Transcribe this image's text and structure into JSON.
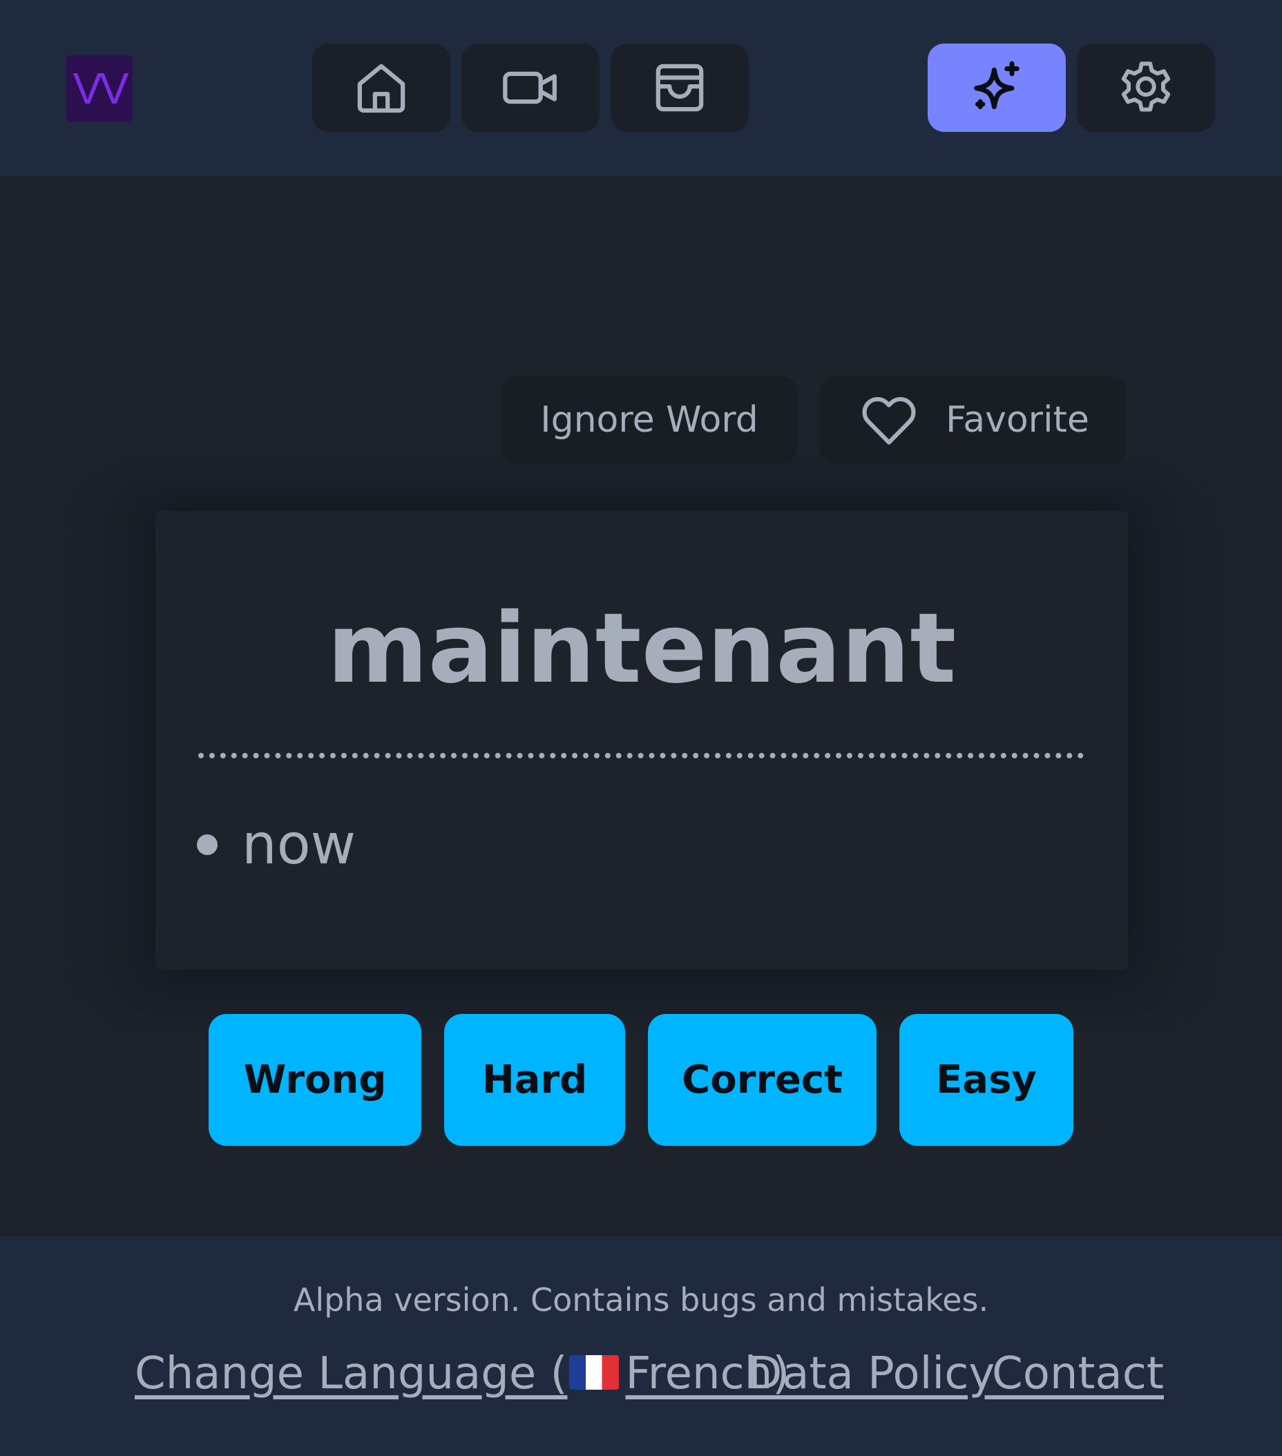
{
  "header": {
    "logo_text": "VV",
    "nav": [
      {
        "name": "home",
        "icon": "home-icon"
      },
      {
        "name": "videos",
        "icon": "video-camera-icon"
      },
      {
        "name": "inbox",
        "icon": "inbox-icon"
      }
    ],
    "right": [
      {
        "name": "ai-sparkle",
        "icon": "sparkle-icon",
        "active": true,
        "color": "#7784fd"
      },
      {
        "name": "settings",
        "icon": "gear-icon"
      }
    ]
  },
  "actions": {
    "ignore_label": "Ignore Word",
    "favorite_label": "Favorite"
  },
  "card": {
    "word": "maintenant",
    "meanings": [
      "now"
    ]
  },
  "grades": {
    "wrong": "Wrong",
    "hard": "Hard",
    "correct": "Correct",
    "easy": "Easy",
    "color": "#00b5ff"
  },
  "footer": {
    "notice": "Alpha version. Contains bugs and mistakes.",
    "language_prefix": "Change Language (",
    "language_flag": "flag-france-icon",
    "language_name": "French)",
    "data_policy": "Data Policy",
    "contact": "Contact"
  }
}
